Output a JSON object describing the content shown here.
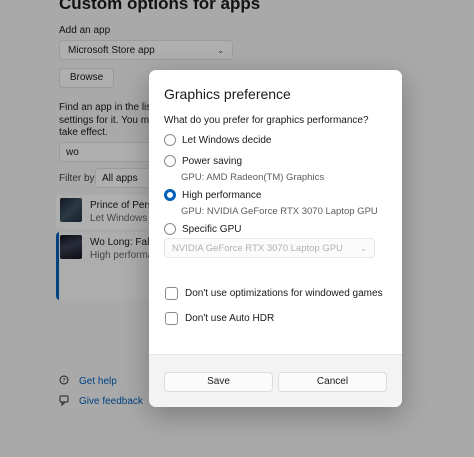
{
  "settings": {
    "title": "Custom options for apps",
    "add_app_label": "Add an app",
    "add_app_dropdown": "Microsoft Store app",
    "browse_button": "Browse",
    "help_lines": [
      "Find an app in the list a",
      "settings for it. You migh",
      "take effect."
    ],
    "search_value": "wo",
    "filter_label": "Filter by:",
    "filter_value": "All apps",
    "apps": [
      {
        "name": "Prince of Persia",
        "subtitle": "Let Windows decide"
      },
      {
        "name": "Wo Long: Fallen",
        "subtitle": "High performance"
      }
    ],
    "links": {
      "help": "Get help",
      "feedback": "Give feedback"
    }
  },
  "dialog": {
    "title": "Graphics preference",
    "question": "What do you prefer for graphics performance?",
    "options": [
      {
        "label": "Let Windows decide",
        "sub": ""
      },
      {
        "label": "Power saving",
        "sub": "GPU: AMD Radeon(TM) Graphics"
      },
      {
        "label": "High performance",
        "sub": "GPU: NVIDIA GeForce RTX 3070 Laptop GPU"
      },
      {
        "label": "Specific GPU",
        "sub": ""
      }
    ],
    "selected_option": "High performance",
    "specific_gpu_value": "NVIDIA GeForce RTX 3070 Laptop GPU",
    "checkboxes": [
      {
        "label": "Don't use optimizations for windowed games",
        "checked": false
      },
      {
        "label": "Don't use Auto HDR",
        "checked": false
      }
    ],
    "save_button": "Save",
    "cancel_button": "Cancel"
  },
  "colors": {
    "accent": "#005fb8",
    "dialog_bg": "#ffffff",
    "footer_bg": "#f3f3f3"
  },
  "icons": [
    "chevron-down-icon",
    "help-icon",
    "feedback-icon"
  ]
}
